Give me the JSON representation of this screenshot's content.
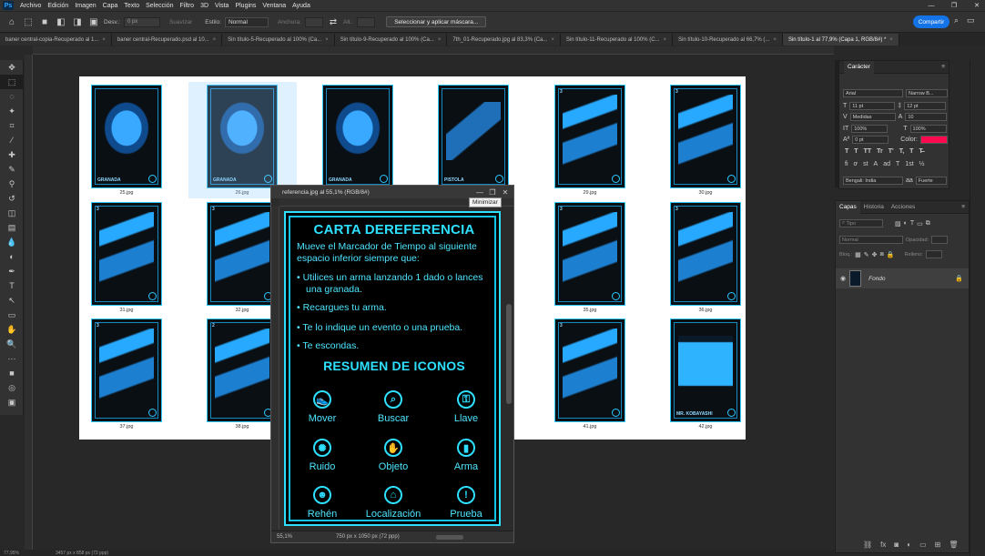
{
  "app": {
    "logo": "Ps"
  },
  "menu": [
    "Archivo",
    "Edición",
    "Imagen",
    "Capa",
    "Texto",
    "Selección",
    "Filtro",
    "3D",
    "Vista",
    "Plugins",
    "Ventana",
    "Ayuda"
  ],
  "window_controls": {
    "minimize": "—",
    "maximize": "❐",
    "close": "✕"
  },
  "options": {
    "feather_label": "Desv.:",
    "feather_value": "0 px",
    "antialias_label": "Suavizar",
    "style_label": "Estilo:",
    "style_value": "Normal",
    "width_label": "Anchura:",
    "height_label": "Alt.:",
    "select_mask_button": "Seleccionar y aplicar máscara...",
    "share_button": "Compartir"
  },
  "tabs": [
    "baner central-copia-Recuperado al 1...",
    "baner central-Recuperado.psd al 10...",
    "Sin título-5-Recuperado al 100% (Ca...",
    "Sin título-9-Recuperado al 100% (Ca...",
    "7th_01-Recuperado.jpg al 83,3% (Ca...",
    "Sin título-11-Recuperado al 100% (C...",
    "Sin título-10-Recuperado al 66,7% (...",
    "Sin título-1 al 77,9% (Capa 1, RGB/8#) *"
  ],
  "tab_close": "×",
  "tool_icons": [
    "move-icon",
    "marquee-icon",
    "lasso-icon",
    "magic-wand-icon",
    "crop-icon",
    "eyedropper-icon",
    "healing-brush-icon",
    "brush-icon",
    "stamp-icon",
    "history-brush-icon",
    "eraser-icon",
    "gradient-icon",
    "blur-icon",
    "dodge-icon",
    "pen-icon",
    "type-icon",
    "path-select-icon",
    "shape-icon",
    "hand-icon",
    "zoom-icon",
    "more-icon",
    "color-swatches-icon",
    "quick-mask-icon",
    "screen-mode-icon"
  ],
  "tool_glyphs": [
    "✥",
    "⬚",
    "◌",
    "✦",
    "⌗",
    "⁄",
    "✚",
    "✎",
    "⚲",
    "↺",
    "◫",
    "▤",
    "💧",
    "◐",
    "✒",
    "T",
    "↖",
    "▭",
    "✋",
    "🔍",
    "···",
    "■",
    "◎",
    "▣"
  ],
  "cards": [
    {
      "file": "25.jpg",
      "label": "GRANADA",
      "kind": "grenade",
      "num": ""
    },
    {
      "file": "26.jpg",
      "label": "GRANADA",
      "kind": "grenade",
      "num": ""
    },
    {
      "file": "",
      "label": "GRANADA",
      "kind": "grenade",
      "num": ""
    },
    {
      "file": "",
      "label": "PISTOLA",
      "kind": "pistol",
      "num": ""
    },
    {
      "file": "29.jpg",
      "label": "",
      "kind": "person",
      "num": "3"
    },
    {
      "file": "30.jpg",
      "label": "",
      "kind": "person",
      "num": "3"
    },
    {
      "file": "31.jpg",
      "label": "",
      "kind": "person",
      "num": "3"
    },
    {
      "file": "32.jpg",
      "label": "",
      "kind": "person",
      "num": "3"
    },
    {
      "file": "",
      "label": "",
      "kind": "person",
      "num": "3"
    },
    {
      "file": "",
      "label": "",
      "kind": "person",
      "num": "3"
    },
    {
      "file": "35.jpg",
      "label": "",
      "kind": "person",
      "num": "3"
    },
    {
      "file": "36.jpg",
      "label": "",
      "kind": "person",
      "num": "3"
    },
    {
      "file": "37.jpg",
      "label": "",
      "kind": "person",
      "num": "3"
    },
    {
      "file": "38.jpg",
      "label": "",
      "kind": "person",
      "num": "2"
    },
    {
      "file": "",
      "label": "",
      "kind": "person",
      "num": ""
    },
    {
      "file": "",
      "label": "",
      "kind": "person",
      "num": ""
    },
    {
      "file": "41.jpg",
      "label": "",
      "kind": "person",
      "num": "3"
    },
    {
      "file": "42.jpg",
      "label": "MR. KOBAYASHI",
      "kind": "boss",
      "num": ""
    }
  ],
  "float_window": {
    "title": "referencia.jpg al 55,1% (RGB/8#)",
    "tooltip": "Minimizar",
    "zoom": "55,1%",
    "dimensions": "750 px x 1050 px (72 ppp)",
    "card": {
      "title": "CARTA DEREFERENCIA",
      "lines": [
        "Mueve el Marcador de Tiempo al siguiente",
        "espacio inferior siempre que:"
      ],
      "bullets": [
        "• Utilices un arma lanzando 1 dado o lances",
        "una granada.",
        "• Recargues tu arma.",
        "• Te lo indique un evento o una prueba.",
        "• Te escondas."
      ],
      "icons_title": "RESUMEN DE ICONOS",
      "icons": [
        {
          "name": "Mover",
          "glyph": "👟"
        },
        {
          "name": "Buscar",
          "glyph": "⌕"
        },
        {
          "name": "Llave",
          "glyph": "⚿"
        },
        {
          "name": "Ruido",
          "glyph": "✺"
        },
        {
          "name": "Objeto",
          "glyph": "✋"
        },
        {
          "name": "Arma",
          "glyph": "▮"
        },
        {
          "name": "Rehén",
          "glyph": "☻"
        },
        {
          "name": "Localización",
          "glyph": "⌂"
        },
        {
          "name": "Prueba",
          "glyph": "!"
        }
      ]
    }
  },
  "character_panel": {
    "title": "Carácter",
    "font_family": "Arial",
    "font_style": "Narrow B...",
    "size": "11 pt",
    "leading": "12 pt",
    "kerning": "Medidas",
    "tracking": "10",
    "v_scale": "100%",
    "h_scale": "100%",
    "baseline": "0 pt",
    "color_label": "Color:",
    "color_hex": "#ff0a4f",
    "type_buttons": [
      "T",
      "T",
      "TT",
      "Tr",
      "T'",
      "T,",
      "T",
      "T̶"
    ],
    "ot_buttons": [
      "fi",
      "ơ",
      "st",
      "A",
      "ad",
      "T",
      "1st",
      "½"
    ],
    "language": "Bengali: India",
    "aa": "Fuerte"
  },
  "layers_panel": {
    "tabs": [
      "Capas",
      "Historia",
      "Acciones"
    ],
    "search_placeholder": "Tipo",
    "blend": "Normal",
    "opacity_label": "Opacidad:",
    "fill_label": "Relleno:",
    "lock_label": "Bloq.:",
    "layer_name": "Fondo"
  },
  "status": {
    "zoom": "77,95%",
    "doc": "3457 px x 858 px (72 ppp)"
  }
}
